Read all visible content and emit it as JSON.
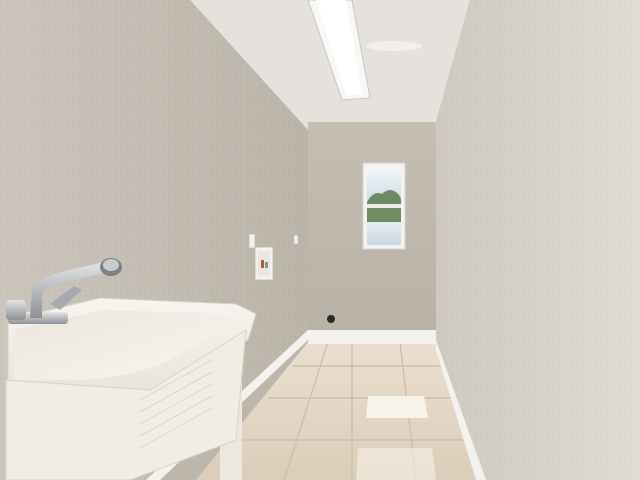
{
  "scene": {
    "colors": {
      "wall_left": "#cfc9bf",
      "wall_right": "#dcd7ce",
      "wall_back": "#bfb8ad",
      "ceiling": "#e3e0da",
      "floor": "#e2d4c2",
      "tile_grout": "#cdbfae",
      "baseboard": "#f4f2ee",
      "sink": "#f4f1ea",
      "faucet": "#b9bcbf",
      "window_sky": "#e6eef4",
      "window_tree": "#5d7a4b"
    },
    "objects": [
      "laundry-sink",
      "faucet",
      "ceiling-light",
      "window",
      "washer-box",
      "light-switch",
      "outlet",
      "dryer-outlet",
      "tile-floor"
    ]
  }
}
